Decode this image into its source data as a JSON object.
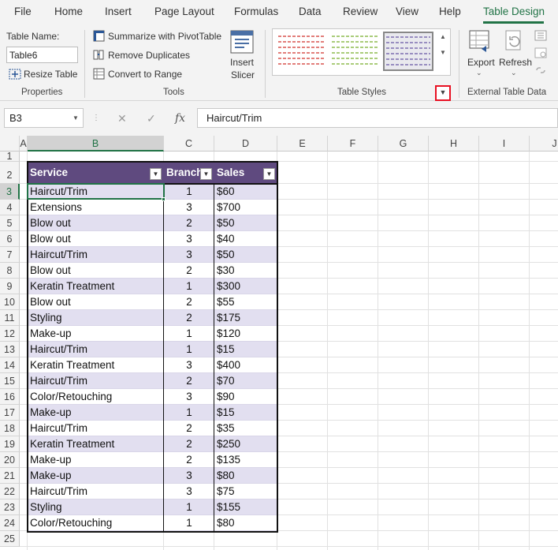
{
  "menu": {
    "tabs": [
      "File",
      "Home",
      "Insert",
      "Page Layout",
      "Formulas",
      "Data",
      "Review",
      "View",
      "Help",
      "Table Design"
    ],
    "active": "Table Design"
  },
  "ribbon": {
    "properties": {
      "table_name_label": "Table Name:",
      "table_name_value": "Table6",
      "resize_label": "Resize Table",
      "group_label": "Properties"
    },
    "tools": {
      "summarize_label": "Summarize with PivotTable",
      "remove_duplicates_label": "Remove Duplicates",
      "convert_label": "Convert to Range",
      "insert_slicer_label_1": "Insert",
      "insert_slicer_label_2": "Slicer",
      "group_label": "Tools"
    },
    "table_styles": {
      "group_label": "Table Styles",
      "styles": [
        {
          "name": "red-style",
          "line_color": "#d9534f"
        },
        {
          "name": "green-style",
          "line_color": "#8dbb4f"
        },
        {
          "name": "purple-style",
          "line_color": "#7e6fb0"
        }
      ],
      "selected_index": 2
    },
    "external": {
      "export_label": "Export",
      "refresh_label": "Refresh",
      "group_label": "External Table Data"
    }
  },
  "formula_bar": {
    "name_box": "B3",
    "formula": "Haircut/Trim"
  },
  "grid": {
    "columns": [
      "A",
      "B",
      "C",
      "D",
      "E",
      "F",
      "G",
      "H",
      "I",
      "J"
    ],
    "selected_column": "B",
    "rows": [
      "1",
      "2",
      "3",
      "4",
      "5",
      "6",
      "7",
      "8",
      "9",
      "10",
      "11",
      "12",
      "13",
      "14",
      "15",
      "16",
      "17",
      "18",
      "19",
      "20",
      "21",
      "22",
      "23",
      "24",
      "25"
    ],
    "selected_row": "3"
  },
  "table": {
    "headers": [
      "Service",
      "Branch",
      "Sales"
    ],
    "rows": [
      [
        "Haircut/Trim",
        "1",
        "$60"
      ],
      [
        "Extensions",
        "3",
        "$700"
      ],
      [
        "Blow out",
        "2",
        "$50"
      ],
      [
        "Blow out",
        "3",
        "$40"
      ],
      [
        "Haircut/Trim",
        "3",
        "$50"
      ],
      [
        "Blow out",
        "2",
        "$30"
      ],
      [
        "Keratin Treatment",
        "1",
        "$300"
      ],
      [
        "Blow out",
        "2",
        "$55"
      ],
      [
        "Styling",
        "2",
        "$175"
      ],
      [
        "Make-up",
        "1",
        "$120"
      ],
      [
        "Haircut/Trim",
        "1",
        "$15"
      ],
      [
        "Keratin Treatment",
        "3",
        "$400"
      ],
      [
        "Haircut/Trim",
        "2",
        "$70"
      ],
      [
        "Color/Retouching",
        "3",
        "$90"
      ],
      [
        "Make-up",
        "1",
        "$15"
      ],
      [
        "Haircut/Trim",
        "2",
        "$35"
      ],
      [
        "Keratin Treatment",
        "2",
        "$250"
      ],
      [
        "Make-up",
        "2",
        "$135"
      ],
      [
        "Make-up",
        "3",
        "$80"
      ],
      [
        "Haircut/Trim",
        "3",
        "$75"
      ],
      [
        "Styling",
        "1",
        "$155"
      ],
      [
        "Color/Retouching",
        "1",
        "$80"
      ]
    ],
    "header_color": "#5f4a7f",
    "band_color": "#e2dff0"
  },
  "colors": {
    "accent": "#217346",
    "highlight_box": "#e81123"
  }
}
